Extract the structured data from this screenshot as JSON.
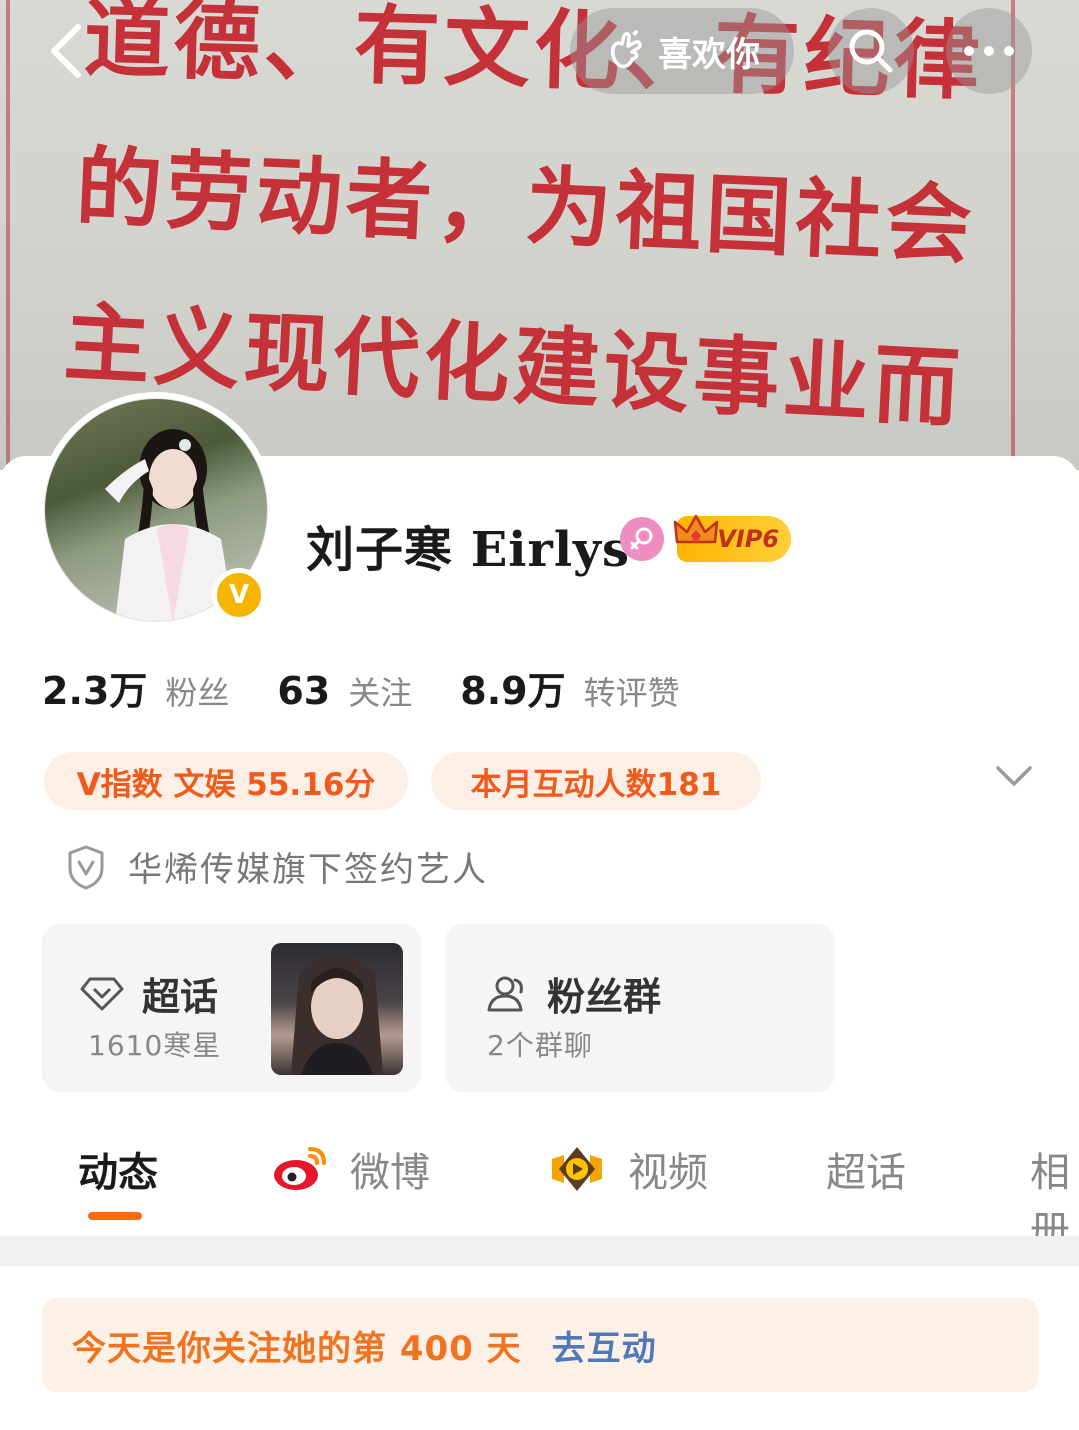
{
  "cover": {
    "lines": [
      "道德、有文化、有纪律",
      "的劳动者，为祖国社会",
      "主义现代化建设事业而"
    ]
  },
  "topbar": {
    "like_label": "喜欢你"
  },
  "profile": {
    "name": "刘子寒 Eirlys",
    "vip_label": "VIP6",
    "verified_badge": "V"
  },
  "stats": [
    {
      "value": "2.3万",
      "label": "粉丝"
    },
    {
      "value": "63",
      "label": "关注"
    },
    {
      "value": "8.9万",
      "label": "转评赞"
    }
  ],
  "pills": {
    "v_index": "V指数 文娱 55.16分",
    "interactions": "本月互动人数181"
  },
  "verification": "华烯传媒旗下签约艺人",
  "super_topic": {
    "title": "超话",
    "sub": "1610寒星"
  },
  "fan_group": {
    "title": "粉丝群",
    "sub": "2个群聊"
  },
  "tabs": [
    "动态",
    "微博",
    "视频",
    "超话",
    "相册"
  ],
  "notice": {
    "text": "今天是你关注她的第 400 天",
    "link": "去互动"
  },
  "colors": {
    "accent": "#ff6a13",
    "pill_bg": "#fdeee6",
    "link": "#4f79b7"
  }
}
